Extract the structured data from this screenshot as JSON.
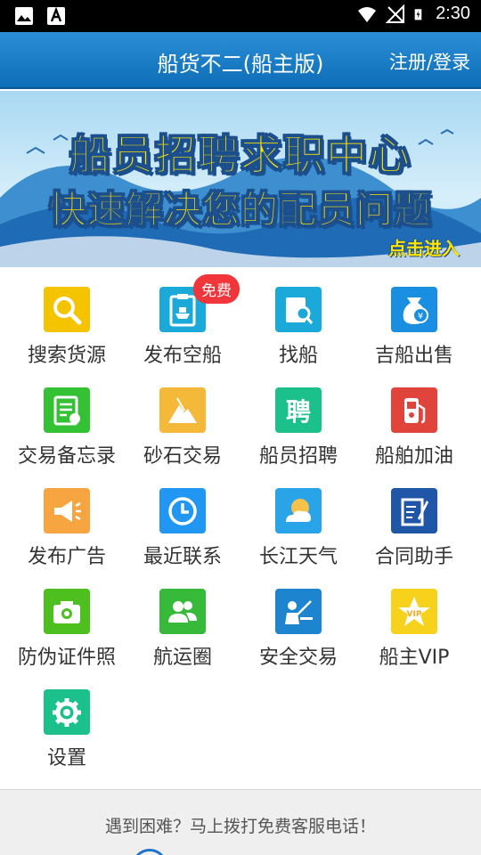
{
  "status_bar": {
    "time": "2:30"
  },
  "header": {
    "title": "船货不二(船主版)",
    "login": "注册/登录"
  },
  "banner": {
    "line1": "船员招聘求职中心",
    "line2": "快速解决您的配员问题",
    "enter": "点击进入"
  },
  "grid": [
    {
      "label": "搜索货源",
      "icon": "search-icon",
      "color": "#f5c400"
    },
    {
      "label": "发布空船",
      "icon": "clipboard-ship-icon",
      "color": "#1aa9d8",
      "badge": "免费"
    },
    {
      "label": "找船",
      "icon": "find-ship-icon",
      "color": "#1aa9d8"
    },
    {
      "label": "吉船出售",
      "icon": "money-bag-icon",
      "color": "#1a8ee0"
    },
    {
      "label": "交易备忘录",
      "icon": "memo-icon",
      "color": "#34c234"
    },
    {
      "label": "砂石交易",
      "icon": "sand-pile-icon",
      "color": "#f5b93a"
    },
    {
      "label": "船员招聘",
      "icon": "recruit-icon",
      "color": "#1cc08a"
    },
    {
      "label": "船舶加油",
      "icon": "fuel-pump-icon",
      "color": "#e0443a"
    },
    {
      "label": "发布广告",
      "icon": "megaphone-icon",
      "color": "#f6a540"
    },
    {
      "label": "最近联系",
      "icon": "clock-icon",
      "color": "#2196f3"
    },
    {
      "label": "长江天气",
      "icon": "weather-icon",
      "color": "#29a4e8"
    },
    {
      "label": "合同助手",
      "icon": "contract-icon",
      "color": "#1f56a8"
    },
    {
      "label": "防伪证件照",
      "icon": "camera-icon",
      "color": "#4dbf1f"
    },
    {
      "label": "航运圈",
      "icon": "people-icon",
      "color": "#37b93a"
    },
    {
      "label": "安全交易",
      "icon": "teacher-icon",
      "color": "#1d84d0"
    },
    {
      "label": "船主VIP",
      "icon": "vip-star-icon",
      "color": "#f7d21c"
    },
    {
      "label": "设置",
      "icon": "gear-icon",
      "color": "#1cc08a"
    }
  ],
  "help": {
    "text": "遇到困难？马上拨打免费客服电话！"
  }
}
